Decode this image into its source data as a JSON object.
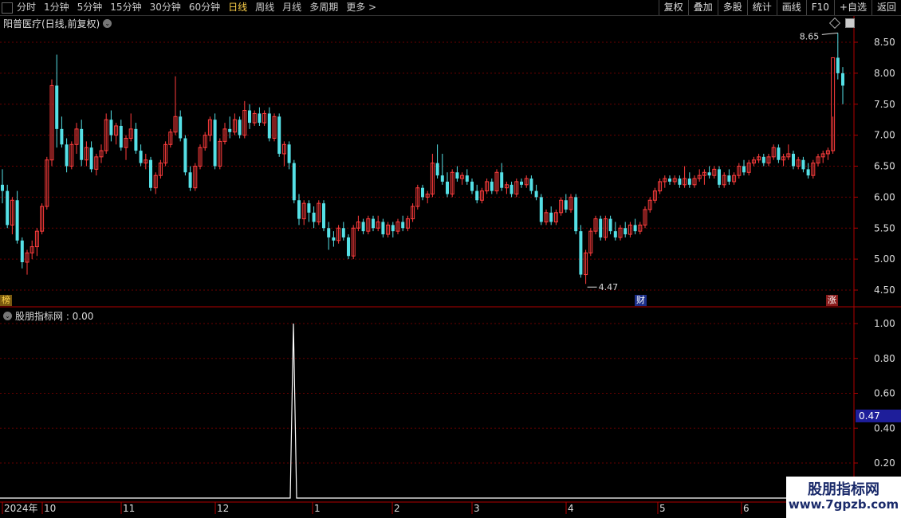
{
  "toolbar": {
    "tabs": [
      "分时",
      "1分钟",
      "5分钟",
      "15分钟",
      "30分钟",
      "60分钟",
      "日线",
      "周线",
      "月线",
      "多周期",
      "更多 >"
    ],
    "active_tab": "日线",
    "right_buttons": [
      "复权",
      "叠加",
      "多股",
      "统计",
      "画线",
      "F10",
      "+自选",
      "返回"
    ]
  },
  "main_title": "阳普医疗(日线,前复权)",
  "indicator_title": "股朋指标网 : 0.00",
  "high_label": "8.65",
  "low_label": "4.47",
  "badges": {
    "left": "榜",
    "cai": "财",
    "zhang": "涨"
  },
  "price_axis": [
    "8.50",
    "8.00",
    "7.50",
    "7.00",
    "6.50",
    "6.00",
    "5.50",
    "5.00",
    "4.50"
  ],
  "indicator_axis": [
    "1.00",
    "0.80",
    "0.60",
    "0.40",
    "0.20"
  ],
  "indicator_current": "0.47",
  "date_axis": [
    "2024年",
    "10",
    "11",
    "12",
    "1",
    "2",
    "3",
    "4",
    "5",
    "6"
  ],
  "watermark": {
    "line1": "股朋指标网",
    "line2": "www.7gpzb.com"
  },
  "colors": {
    "up": "#ff3d3d",
    "down": "#55e0e6",
    "axis_red": "#b00000",
    "highlight": "#1e1e9a"
  },
  "chart_data": {
    "type": "candlestick",
    "ylim": [
      4.3,
      8.8
    ],
    "candles": [
      [
        6.2,
        6.45,
        5.9,
        6.1
      ],
      [
        6.1,
        6.2,
        5.5,
        5.55
      ],
      [
        5.55,
        6.0,
        5.4,
        5.95
      ],
      [
        5.95,
        6.1,
        5.25,
        5.3
      ],
      [
        5.3,
        5.35,
        4.85,
        4.95
      ],
      [
        4.95,
        5.15,
        4.75,
        5.1
      ],
      [
        5.1,
        5.3,
        5.0,
        5.2
      ],
      [
        5.2,
        5.5,
        5.05,
        5.45
      ],
      [
        5.45,
        5.9,
        5.4,
        5.85
      ],
      [
        5.85,
        6.65,
        5.8,
        6.6
      ],
      [
        6.6,
        7.9,
        6.5,
        7.8
      ],
      [
        7.8,
        8.3,
        6.8,
        7.1
      ],
      [
        7.1,
        7.3,
        6.8,
        6.85
      ],
      [
        6.85,
        6.95,
        6.4,
        6.5
      ],
      [
        6.5,
        6.9,
        6.45,
        6.85
      ],
      [
        6.85,
        7.2,
        6.7,
        7.1
      ],
      [
        7.1,
        7.25,
        6.5,
        6.6
      ],
      [
        6.6,
        6.9,
        6.5,
        6.8
      ],
      [
        6.8,
        6.9,
        6.4,
        6.45
      ],
      [
        6.45,
        6.7,
        6.35,
        6.65
      ],
      [
        6.65,
        6.85,
        6.55,
        6.75
      ],
      [
        6.75,
        7.35,
        6.7,
        7.25
      ],
      [
        7.25,
        7.4,
        6.9,
        7.0
      ],
      [
        7.0,
        7.2,
        6.85,
        7.15
      ],
      [
        7.15,
        7.25,
        6.75,
        6.8
      ],
      [
        6.8,
        7.0,
        6.6,
        6.95
      ],
      [
        6.95,
        7.35,
        6.9,
        7.1
      ],
      [
        7.1,
        7.2,
        6.7,
        6.75
      ],
      [
        6.75,
        6.85,
        6.5,
        6.55
      ],
      [
        6.55,
        6.7,
        6.45,
        6.6
      ],
      [
        6.6,
        6.65,
        6.1,
        6.15
      ],
      [
        6.15,
        6.4,
        6.05,
        6.35
      ],
      [
        6.35,
        6.6,
        6.3,
        6.55
      ],
      [
        6.55,
        6.9,
        6.5,
        6.85
      ],
      [
        6.85,
        7.1,
        6.8,
        7.05
      ],
      [
        7.05,
        7.95,
        7.0,
        7.3
      ],
      [
        7.3,
        7.4,
        6.9,
        6.95
      ],
      [
        6.95,
        7.0,
        6.35,
        6.4
      ],
      [
        6.4,
        6.5,
        6.1,
        6.15
      ],
      [
        6.15,
        6.55,
        6.1,
        6.5
      ],
      [
        6.5,
        6.85,
        6.45,
        6.8
      ],
      [
        6.8,
        7.05,
        6.75,
        7.0
      ],
      [
        7.0,
        7.3,
        6.9,
        7.25
      ],
      [
        7.25,
        7.35,
        6.45,
        6.5
      ],
      [
        6.5,
        6.95,
        6.45,
        6.9
      ],
      [
        6.9,
        7.2,
        6.85,
        7.1
      ],
      [
        7.1,
        7.3,
        6.95,
        7.05
      ],
      [
        7.05,
        7.35,
        7.0,
        7.25
      ],
      [
        7.25,
        7.3,
        6.95,
        7.0
      ],
      [
        7.0,
        7.55,
        6.95,
        7.4
      ],
      [
        7.4,
        7.5,
        7.1,
        7.2
      ],
      [
        7.2,
        7.4,
        7.15,
        7.35
      ],
      [
        7.35,
        7.45,
        7.15,
        7.2
      ],
      [
        7.2,
        7.4,
        7.15,
        7.35
      ],
      [
        7.35,
        7.45,
        6.9,
        6.95
      ],
      [
        6.95,
        7.35,
        6.9,
        7.3
      ],
      [
        7.3,
        7.35,
        6.65,
        6.7
      ],
      [
        6.7,
        6.9,
        6.5,
        6.85
      ],
      [
        6.85,
        6.9,
        6.45,
        6.55
      ],
      [
        6.55,
        6.6,
        5.9,
        5.95
      ],
      [
        5.95,
        6.05,
        5.55,
        5.65
      ],
      [
        5.65,
        5.95,
        5.55,
        5.9
      ],
      [
        5.9,
        5.95,
        5.6,
        5.75
      ],
      [
        5.75,
        5.85,
        5.5,
        5.6
      ],
      [
        5.6,
        5.95,
        5.55,
        5.9
      ],
      [
        5.9,
        5.95,
        5.45,
        5.5
      ],
      [
        5.5,
        5.6,
        5.15,
        5.35
      ],
      [
        5.35,
        5.45,
        5.2,
        5.3
      ],
      [
        5.3,
        5.55,
        5.25,
        5.5
      ],
      [
        5.5,
        5.6,
        5.3,
        5.35
      ],
      [
        5.35,
        5.4,
        5.0,
        5.05
      ],
      [
        5.05,
        5.55,
        5.0,
        5.5
      ],
      [
        5.5,
        5.7,
        5.45,
        5.6
      ],
      [
        5.6,
        5.65,
        5.4,
        5.45
      ],
      [
        5.45,
        5.7,
        5.4,
        5.65
      ],
      [
        5.65,
        5.7,
        5.45,
        5.5
      ],
      [
        5.5,
        5.7,
        5.45,
        5.6
      ],
      [
        5.6,
        5.65,
        5.35,
        5.4
      ],
      [
        5.4,
        5.6,
        5.35,
        5.55
      ],
      [
        5.55,
        5.6,
        5.35,
        5.45
      ],
      [
        5.45,
        5.65,
        5.4,
        5.6
      ],
      [
        5.6,
        5.7,
        5.45,
        5.5
      ],
      [
        5.5,
        5.7,
        5.45,
        5.65
      ],
      [
        5.65,
        5.9,
        5.6,
        5.85
      ],
      [
        5.85,
        6.2,
        5.8,
        6.15
      ],
      [
        6.15,
        6.2,
        5.95,
        6.0
      ],
      [
        6.0,
        6.1,
        5.9,
        6.05
      ],
      [
        6.05,
        6.7,
        6.0,
        6.55
      ],
      [
        6.55,
        6.85,
        6.3,
        6.35
      ],
      [
        6.35,
        6.7,
        6.2,
        6.25
      ],
      [
        6.25,
        6.4,
        6.0,
        6.05
      ],
      [
        6.05,
        6.45,
        6.0,
        6.4
      ],
      [
        6.4,
        6.5,
        6.25,
        6.3
      ],
      [
        6.3,
        6.4,
        6.2,
        6.35
      ],
      [
        6.35,
        6.45,
        6.2,
        6.25
      ],
      [
        6.25,
        6.3,
        6.05,
        6.1
      ],
      [
        6.1,
        6.2,
        5.9,
        5.95
      ],
      [
        5.95,
        6.15,
        5.9,
        6.1
      ],
      [
        6.1,
        6.3,
        6.05,
        6.25
      ],
      [
        6.25,
        6.3,
        6.05,
        6.1
      ],
      [
        6.1,
        6.45,
        6.05,
        6.4
      ],
      [
        6.4,
        6.55,
        6.1,
        6.15
      ],
      [
        6.15,
        6.25,
        6.05,
        6.2
      ],
      [
        6.2,
        6.25,
        6.0,
        6.05
      ],
      [
        6.05,
        6.3,
        6.0,
        6.25
      ],
      [
        6.25,
        6.3,
        6.15,
        6.2
      ],
      [
        6.2,
        6.35,
        6.15,
        6.3
      ],
      [
        6.3,
        6.35,
        6.05,
        6.1
      ],
      [
        6.1,
        6.2,
        5.95,
        6.0
      ],
      [
        6.0,
        6.05,
        5.55,
        5.6
      ],
      [
        5.6,
        5.8,
        5.55,
        5.75
      ],
      [
        5.75,
        5.85,
        5.55,
        5.6
      ],
      [
        5.6,
        5.8,
        5.55,
        5.75
      ],
      [
        5.75,
        6.0,
        5.7,
        5.95
      ],
      [
        5.95,
        6.05,
        5.75,
        5.8
      ],
      [
        5.8,
        6.05,
        5.75,
        6.0
      ],
      [
        6.0,
        6.05,
        5.4,
        5.45
      ],
      [
        5.45,
        5.55,
        4.7,
        4.75
      ],
      [
        4.75,
        5.15,
        4.6,
        5.1
      ],
      [
        5.1,
        5.5,
        5.05,
        5.45
      ],
      [
        5.45,
        5.7,
        5.4,
        5.65
      ],
      [
        5.65,
        5.7,
        5.3,
        5.35
      ],
      [
        5.35,
        5.7,
        5.3,
        5.65
      ],
      [
        5.65,
        5.7,
        5.4,
        5.45
      ],
      [
        5.45,
        5.6,
        5.3,
        5.35
      ],
      [
        5.35,
        5.55,
        5.3,
        5.5
      ],
      [
        5.5,
        5.6,
        5.35,
        5.4
      ],
      [
        5.4,
        5.6,
        5.35,
        5.55
      ],
      [
        5.55,
        5.65,
        5.4,
        5.45
      ],
      [
        5.45,
        5.6,
        5.4,
        5.55
      ],
      [
        5.55,
        5.85,
        5.5,
        5.8
      ],
      [
        5.8,
        6.0,
        5.75,
        5.95
      ],
      [
        5.95,
        6.15,
        5.9,
        6.1
      ],
      [
        6.1,
        6.3,
        6.05,
        6.25
      ],
      [
        6.25,
        6.35,
        6.15,
        6.3
      ],
      [
        6.3,
        6.35,
        6.2,
        6.25
      ],
      [
        6.25,
        6.35,
        6.2,
        6.3
      ],
      [
        6.3,
        6.35,
        6.15,
        6.2
      ],
      [
        6.2,
        6.5,
        6.15,
        6.3
      ],
      [
        6.3,
        6.4,
        6.15,
        6.2
      ],
      [
        6.2,
        6.35,
        6.15,
        6.3
      ],
      [
        6.3,
        6.45,
        6.25,
        6.35
      ],
      [
        6.35,
        6.45,
        6.2,
        6.4
      ],
      [
        6.4,
        6.5,
        6.3,
        6.35
      ],
      [
        6.35,
        6.5,
        6.3,
        6.45
      ],
      [
        6.45,
        6.5,
        6.15,
        6.2
      ],
      [
        6.2,
        6.4,
        6.15,
        6.35
      ],
      [
        6.35,
        6.45,
        6.2,
        6.25
      ],
      [
        6.25,
        6.4,
        6.2,
        6.35
      ],
      [
        6.35,
        6.55,
        6.3,
        6.5
      ],
      [
        6.5,
        6.6,
        6.35,
        6.4
      ],
      [
        6.4,
        6.6,
        6.35,
        6.55
      ],
      [
        6.55,
        6.65,
        6.5,
        6.6
      ],
      [
        6.6,
        6.7,
        6.55,
        6.65
      ],
      [
        6.65,
        6.7,
        6.5,
        6.55
      ],
      [
        6.55,
        6.7,
        6.5,
        6.65
      ],
      [
        6.65,
        6.85,
        6.6,
        6.8
      ],
      [
        6.8,
        6.85,
        6.55,
        6.6
      ],
      [
        6.6,
        6.7,
        6.5,
        6.65
      ],
      [
        6.65,
        6.85,
        6.6,
        6.7
      ],
      [
        6.7,
        6.75,
        6.45,
        6.5
      ],
      [
        6.5,
        6.65,
        6.45,
        6.6
      ],
      [
        6.6,
        6.65,
        6.4,
        6.45
      ],
      [
        6.45,
        6.55,
        6.3,
        6.35
      ],
      [
        6.35,
        6.6,
        6.3,
        6.55
      ],
      [
        6.55,
        6.7,
        6.5,
        6.65
      ],
      [
        6.65,
        6.75,
        6.55,
        6.7
      ],
      [
        6.7,
        6.8,
        6.6,
        6.75
      ],
      [
        6.75,
        7.3,
        6.7,
        8.25
      ],
      [
        8.25,
        8.65,
        7.9,
        8.0
      ],
      [
        8.0,
        8.1,
        7.5,
        7.8
      ]
    ],
    "indicator": {
      "ylim": [
        0,
        1.05
      ],
      "spike_index": 40,
      "values_note": "all 0 except a single spike to 1.00"
    }
  }
}
